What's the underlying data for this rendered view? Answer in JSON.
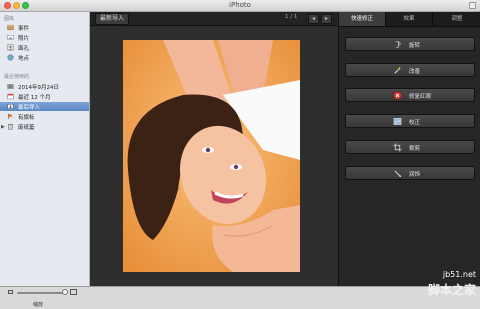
{
  "window": {
    "title": "iPhoto"
  },
  "sidebar": {
    "library_heading": "图库",
    "library_items": [
      {
        "label": "事件",
        "icon": "events-icon"
      },
      {
        "label": "照片",
        "icon": "photos-icon"
      },
      {
        "label": "面孔",
        "icon": "faces-icon"
      },
      {
        "label": "地点",
        "icon": "places-icon"
      }
    ],
    "recent_heading": "最近使用的",
    "recent_items": [
      {
        "label": "2014年9月24日",
        "icon": "event-icon"
      },
      {
        "label": "最近 12 个月",
        "icon": "calendar-icon"
      },
      {
        "label": "最后导入",
        "icon": "last-import-icon",
        "selected": true
      },
      {
        "label": "有旗标",
        "icon": "flag-icon"
      },
      {
        "label": "废纸篓",
        "icon": "trash-icon"
      }
    ]
  },
  "main": {
    "breadcrumb": "最新导入",
    "page_counter": "1 / 1",
    "prev": "◂",
    "next": "▸"
  },
  "panel": {
    "tabs": [
      "快速修正",
      "效果",
      "调整"
    ],
    "active_tab": 0,
    "tools": [
      {
        "label": "旋转",
        "icon": "rotate-icon"
      },
      {
        "label": "改善",
        "icon": "enhance-icon"
      },
      {
        "label": "修复红眼",
        "icon": "red-eye-icon"
      },
      {
        "label": "校正",
        "icon": "straighten-icon"
      },
      {
        "label": "裁剪",
        "icon": "crop-icon"
      },
      {
        "label": "润饰",
        "icon": "retouch-icon"
      }
    ]
  },
  "bottom": {
    "zoom_label": "缩放"
  },
  "watermark": {
    "line1": "jb51.net",
    "line2": "脚本之家"
  },
  "colors": {
    "selected_row": "#5a86c4",
    "panel_bg": "#262626",
    "red_eye_badge": "#d9322b"
  }
}
